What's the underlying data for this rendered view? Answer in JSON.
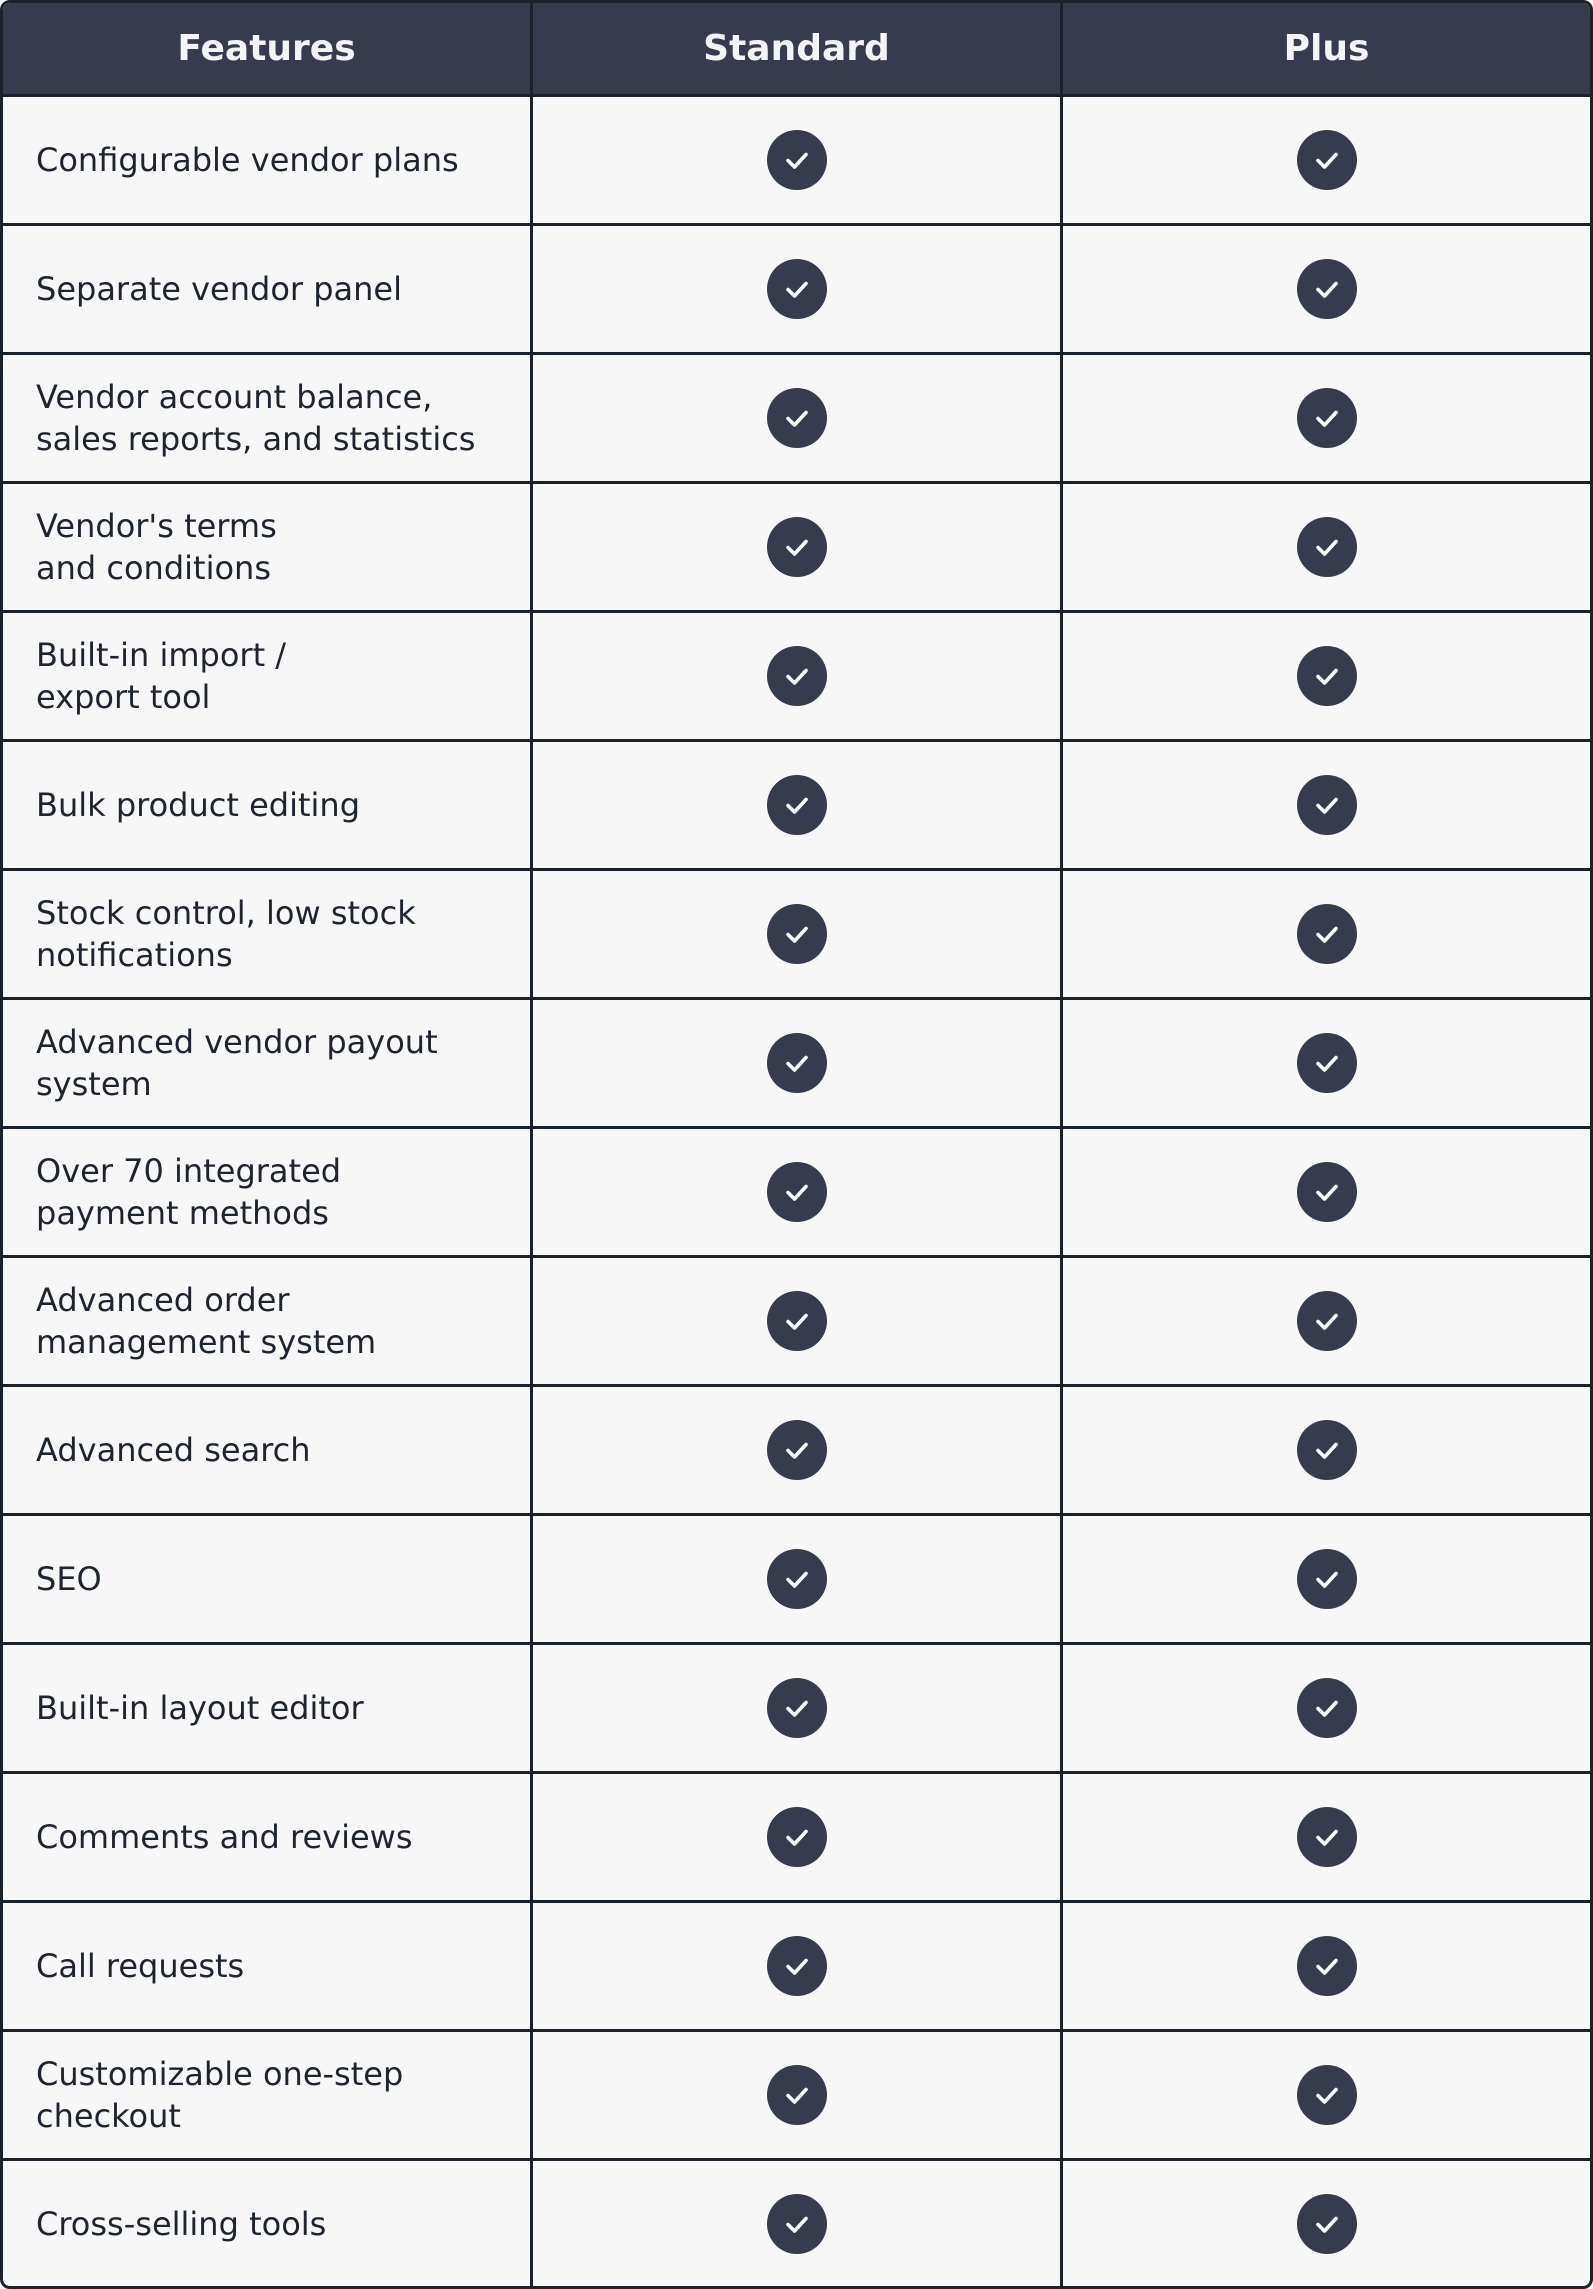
{
  "table": {
    "headers": [
      "Features",
      "Standard",
      "Plus"
    ],
    "check_icon": "check-circle-icon",
    "rows": [
      {
        "feature": "Configurable vendor plans",
        "standard": true,
        "plus": true
      },
      {
        "feature": "Separate vendor panel",
        "standard": true,
        "plus": true
      },
      {
        "feature": "Vendor account balance,\nsales reports, and statistics",
        "standard": true,
        "plus": true
      },
      {
        "feature": "Vendor's terms\nand conditions",
        "standard": true,
        "plus": true
      },
      {
        "feature": "Built-in import /\nexport tool",
        "standard": true,
        "plus": true
      },
      {
        "feature": "Bulk product editing",
        "standard": true,
        "plus": true
      },
      {
        "feature": "Stock control, low stock\nnotifications",
        "standard": true,
        "plus": true
      },
      {
        "feature": "Advanced vendor payout\nsystem",
        "standard": true,
        "plus": true
      },
      {
        "feature": "Over 70 integrated\npayment methods",
        "standard": true,
        "plus": true
      },
      {
        "feature": "Advanced order\nmanagement system",
        "standard": true,
        "plus": true
      },
      {
        "feature": "Advanced search",
        "standard": true,
        "plus": true
      },
      {
        "feature": "SEO",
        "standard": true,
        "plus": true
      },
      {
        "feature": "Built-in layout editor",
        "standard": true,
        "plus": true
      },
      {
        "feature": "Comments and reviews",
        "standard": true,
        "plus": true
      },
      {
        "feature": "Call requests",
        "standard": true,
        "plus": true
      },
      {
        "feature": "Customizable one-step\ncheckout",
        "standard": true,
        "plus": true
      },
      {
        "feature": "Cross-selling tools",
        "standard": true,
        "plus": true
      }
    ]
  },
  "colors": {
    "header_bg": "#363b4d",
    "body_bg": "#f7f7f7",
    "border": "#1b222c",
    "text": "#1e2530",
    "check_bg": "#363b4d"
  }
}
